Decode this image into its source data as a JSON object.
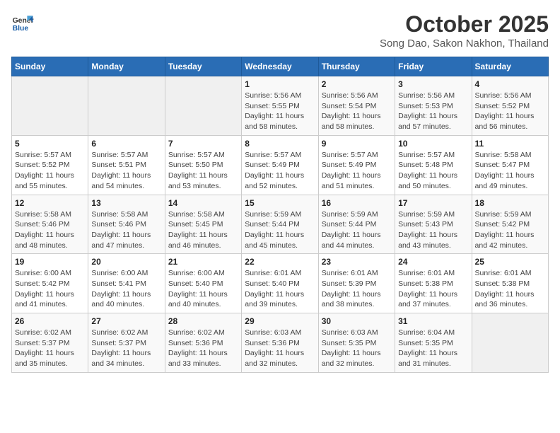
{
  "logo": {
    "line1": "General",
    "line2": "Blue"
  },
  "title": "October 2025",
  "subtitle": "Song Dao, Sakon Nakhon, Thailand",
  "weekdays": [
    "Sunday",
    "Monday",
    "Tuesday",
    "Wednesday",
    "Thursday",
    "Friday",
    "Saturday"
  ],
  "weeks": [
    [
      {
        "day": "",
        "info": ""
      },
      {
        "day": "",
        "info": ""
      },
      {
        "day": "",
        "info": ""
      },
      {
        "day": "1",
        "info": "Sunrise: 5:56 AM\nSunset: 5:55 PM\nDaylight: 11 hours\nand 58 minutes."
      },
      {
        "day": "2",
        "info": "Sunrise: 5:56 AM\nSunset: 5:54 PM\nDaylight: 11 hours\nand 58 minutes."
      },
      {
        "day": "3",
        "info": "Sunrise: 5:56 AM\nSunset: 5:53 PM\nDaylight: 11 hours\nand 57 minutes."
      },
      {
        "day": "4",
        "info": "Sunrise: 5:56 AM\nSunset: 5:52 PM\nDaylight: 11 hours\nand 56 minutes."
      }
    ],
    [
      {
        "day": "5",
        "info": "Sunrise: 5:57 AM\nSunset: 5:52 PM\nDaylight: 11 hours\nand 55 minutes."
      },
      {
        "day": "6",
        "info": "Sunrise: 5:57 AM\nSunset: 5:51 PM\nDaylight: 11 hours\nand 54 minutes."
      },
      {
        "day": "7",
        "info": "Sunrise: 5:57 AM\nSunset: 5:50 PM\nDaylight: 11 hours\nand 53 minutes."
      },
      {
        "day": "8",
        "info": "Sunrise: 5:57 AM\nSunset: 5:49 PM\nDaylight: 11 hours\nand 52 minutes."
      },
      {
        "day": "9",
        "info": "Sunrise: 5:57 AM\nSunset: 5:49 PM\nDaylight: 11 hours\nand 51 minutes."
      },
      {
        "day": "10",
        "info": "Sunrise: 5:57 AM\nSunset: 5:48 PM\nDaylight: 11 hours\nand 50 minutes."
      },
      {
        "day": "11",
        "info": "Sunrise: 5:58 AM\nSunset: 5:47 PM\nDaylight: 11 hours\nand 49 minutes."
      }
    ],
    [
      {
        "day": "12",
        "info": "Sunrise: 5:58 AM\nSunset: 5:46 PM\nDaylight: 11 hours\nand 48 minutes."
      },
      {
        "day": "13",
        "info": "Sunrise: 5:58 AM\nSunset: 5:46 PM\nDaylight: 11 hours\nand 47 minutes."
      },
      {
        "day": "14",
        "info": "Sunrise: 5:58 AM\nSunset: 5:45 PM\nDaylight: 11 hours\nand 46 minutes."
      },
      {
        "day": "15",
        "info": "Sunrise: 5:59 AM\nSunset: 5:44 PM\nDaylight: 11 hours\nand 45 minutes."
      },
      {
        "day": "16",
        "info": "Sunrise: 5:59 AM\nSunset: 5:44 PM\nDaylight: 11 hours\nand 44 minutes."
      },
      {
        "day": "17",
        "info": "Sunrise: 5:59 AM\nSunset: 5:43 PM\nDaylight: 11 hours\nand 43 minutes."
      },
      {
        "day": "18",
        "info": "Sunrise: 5:59 AM\nSunset: 5:42 PM\nDaylight: 11 hours\nand 42 minutes."
      }
    ],
    [
      {
        "day": "19",
        "info": "Sunrise: 6:00 AM\nSunset: 5:42 PM\nDaylight: 11 hours\nand 41 minutes."
      },
      {
        "day": "20",
        "info": "Sunrise: 6:00 AM\nSunset: 5:41 PM\nDaylight: 11 hours\nand 40 minutes."
      },
      {
        "day": "21",
        "info": "Sunrise: 6:00 AM\nSunset: 5:40 PM\nDaylight: 11 hours\nand 40 minutes."
      },
      {
        "day": "22",
        "info": "Sunrise: 6:01 AM\nSunset: 5:40 PM\nDaylight: 11 hours\nand 39 minutes."
      },
      {
        "day": "23",
        "info": "Sunrise: 6:01 AM\nSunset: 5:39 PM\nDaylight: 11 hours\nand 38 minutes."
      },
      {
        "day": "24",
        "info": "Sunrise: 6:01 AM\nSunset: 5:38 PM\nDaylight: 11 hours\nand 37 minutes."
      },
      {
        "day": "25",
        "info": "Sunrise: 6:01 AM\nSunset: 5:38 PM\nDaylight: 11 hours\nand 36 minutes."
      }
    ],
    [
      {
        "day": "26",
        "info": "Sunrise: 6:02 AM\nSunset: 5:37 PM\nDaylight: 11 hours\nand 35 minutes."
      },
      {
        "day": "27",
        "info": "Sunrise: 6:02 AM\nSunset: 5:37 PM\nDaylight: 11 hours\nand 34 minutes."
      },
      {
        "day": "28",
        "info": "Sunrise: 6:02 AM\nSunset: 5:36 PM\nDaylight: 11 hours\nand 33 minutes."
      },
      {
        "day": "29",
        "info": "Sunrise: 6:03 AM\nSunset: 5:36 PM\nDaylight: 11 hours\nand 32 minutes."
      },
      {
        "day": "30",
        "info": "Sunrise: 6:03 AM\nSunset: 5:35 PM\nDaylight: 11 hours\nand 32 minutes."
      },
      {
        "day": "31",
        "info": "Sunrise: 6:04 AM\nSunset: 5:35 PM\nDaylight: 11 hours\nand 31 minutes."
      },
      {
        "day": "",
        "info": ""
      }
    ]
  ]
}
